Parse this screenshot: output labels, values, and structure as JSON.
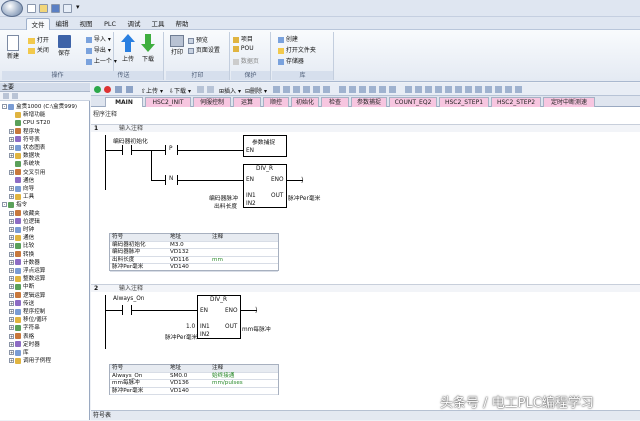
{
  "menu": {
    "tabs": [
      "文件",
      "编辑",
      "视图",
      "PLC",
      "调试",
      "工具",
      "帮助"
    ]
  },
  "ribbon": {
    "groups": [
      {
        "label": "操作",
        "buttons": [
          "新建",
          "打开",
          "关闭",
          "保存"
        ]
      },
      {
        "label": "传送",
        "buttons": [
          "导入",
          "导出",
          "上一个",
          "上传",
          "下载"
        ]
      },
      {
        "label": "打印",
        "buttons": [
          "打印",
          "预览",
          "页面设置"
        ]
      },
      {
        "label": "保护",
        "buttons": [
          "项目",
          "POU",
          "数据页"
        ]
      },
      {
        "label": "库",
        "buttons": [
          "创建",
          "打开文件夹",
          "存储器"
        ]
      }
    ]
  },
  "left_panel": {
    "title": "主要",
    "tree": [
      {
        "label": "盒贯1000 (C:\\盒贯999)",
        "level": 0,
        "exp": "-"
      },
      {
        "label": "新增功能",
        "level": 1,
        "exp": ""
      },
      {
        "label": "CPU ST20",
        "level": 1,
        "exp": ""
      },
      {
        "label": "程序块",
        "level": 1,
        "exp": "+"
      },
      {
        "label": "符号表",
        "level": 1,
        "exp": "+"
      },
      {
        "label": "状态图表",
        "level": 1,
        "exp": "+"
      },
      {
        "label": "数据块",
        "level": 1,
        "exp": "+"
      },
      {
        "label": "系统块",
        "level": 1,
        "exp": ""
      },
      {
        "label": "交叉引用",
        "level": 1,
        "exp": "+"
      },
      {
        "label": "通信",
        "level": 1,
        "exp": ""
      },
      {
        "label": "向导",
        "level": 1,
        "exp": "+"
      },
      {
        "label": "工具",
        "level": 1,
        "exp": "+"
      },
      {
        "label": "指令",
        "level": 0,
        "exp": "-"
      },
      {
        "label": "收藏夹",
        "level": 1,
        "exp": "+"
      },
      {
        "label": "位逻辑",
        "level": 1,
        "exp": "+"
      },
      {
        "label": "时钟",
        "level": 1,
        "exp": "+"
      },
      {
        "label": "通信",
        "level": 1,
        "exp": "+"
      },
      {
        "label": "比较",
        "level": 1,
        "exp": "+"
      },
      {
        "label": "转换",
        "level": 1,
        "exp": "+"
      },
      {
        "label": "计数器",
        "level": 1,
        "exp": "+"
      },
      {
        "label": "浮点运算",
        "level": 1,
        "exp": "+"
      },
      {
        "label": "整数运算",
        "level": 1,
        "exp": "+"
      },
      {
        "label": "中断",
        "level": 1,
        "exp": "+"
      },
      {
        "label": "逻辑运算",
        "level": 1,
        "exp": "+"
      },
      {
        "label": "传送",
        "level": 1,
        "exp": "+"
      },
      {
        "label": "程序控制",
        "level": 1,
        "exp": "+"
      },
      {
        "label": "移位/循环",
        "level": 1,
        "exp": "+"
      },
      {
        "label": "字符串",
        "level": 1,
        "exp": "+"
      },
      {
        "label": "表格",
        "level": 1,
        "exp": "+"
      },
      {
        "label": "定时器",
        "level": 1,
        "exp": "+"
      },
      {
        "label": "库",
        "level": 1,
        "exp": "+"
      },
      {
        "label": "调用子例程",
        "level": 1,
        "exp": "+"
      }
    ]
  },
  "editor": {
    "toolbar": {
      "upload": "上传",
      "download": "下载",
      "insert": "插入",
      "delete": "删除"
    },
    "tabs": [
      {
        "label": "MAIN",
        "color": "#ffffff"
      },
      {
        "label": "HSC2_INIT",
        "color": "#f7c6e0"
      },
      {
        "label": "伺服控制",
        "color": "#f7c6e0"
      },
      {
        "label": "运算",
        "color": "#f7c6e0"
      },
      {
        "label": "顺控",
        "color": "#f7c6e0"
      },
      {
        "label": "初始化",
        "color": "#f7c6e0"
      },
      {
        "label": "检查",
        "color": "#f7c6e0"
      },
      {
        "label": "参数捕捉",
        "color": "#f7c6e0"
      },
      {
        "label": "COUNT_EQ2",
        "color": "#f7c6e0"
      },
      {
        "label": "HSC2_STEP1",
        "color": "#f7c6e0"
      },
      {
        "label": "HSC2_STEP2",
        "color": "#f7c6e0"
      },
      {
        "label": "定时中断测速",
        "color": "#f7c6e0"
      }
    ],
    "program_comment": "程序注释",
    "network1": {
      "number": "1",
      "comment": "输入注释",
      "contact_label": "编码器初始化",
      "p_label": "P",
      "n_label": "N",
      "box1_title": "参数捕捉",
      "box1_en": "EN",
      "box2_title": "DIV_R",
      "box2_en": "EN",
      "box2_eno": "ENO",
      "box2_in1_sym": "编码器脉冲",
      "box2_in1": "IN1",
      "box2_in2_sym": "出料长度",
      "box2_in2": "IN2",
      "box2_out": "OUT",
      "box2_out_sym": "脉冲Per毫米",
      "symtable": {
        "headers": [
          "符号",
          "地址",
          "注释"
        ],
        "rows": [
          [
            "编码器初始化",
            "M3.0",
            ""
          ],
          [
            "编码器脉冲",
            "VD132",
            ""
          ],
          [
            "出料长度",
            "VD116",
            "mm"
          ],
          [
            "脉冲Per毫米",
            "VD140",
            ""
          ]
        ]
      }
    },
    "network2": {
      "number": "2",
      "comment": "输入注释",
      "contact_label": "Always_On",
      "box_title": "DIV_R",
      "box_en": "EN",
      "box_eno": "ENO",
      "in1_val": "1.0",
      "in1": "IN1",
      "in2_sym": "脉冲Per毫米",
      "in2": "IN2",
      "out": "OUT",
      "out_sym": "mm每脉冲",
      "symtable": {
        "headers": [
          "符号",
          "地址",
          "注释"
        ],
        "rows": [
          [
            "Always_On",
            "SM0.0",
            "始终接通"
          ],
          [
            "mm每脉冲",
            "VD136",
            "mm/pulses"
          ],
          [
            "脉冲Per毫米",
            "VD140",
            ""
          ]
        ]
      }
    }
  },
  "status_bar": {
    "label": "符号表"
  },
  "watermark": "头条号 / 电工PLC编程学习",
  "colors": {
    "accent": "#2a6fc9",
    "tab_pink": "#f7c6e0",
    "title_blue": "#dfe6f1"
  }
}
